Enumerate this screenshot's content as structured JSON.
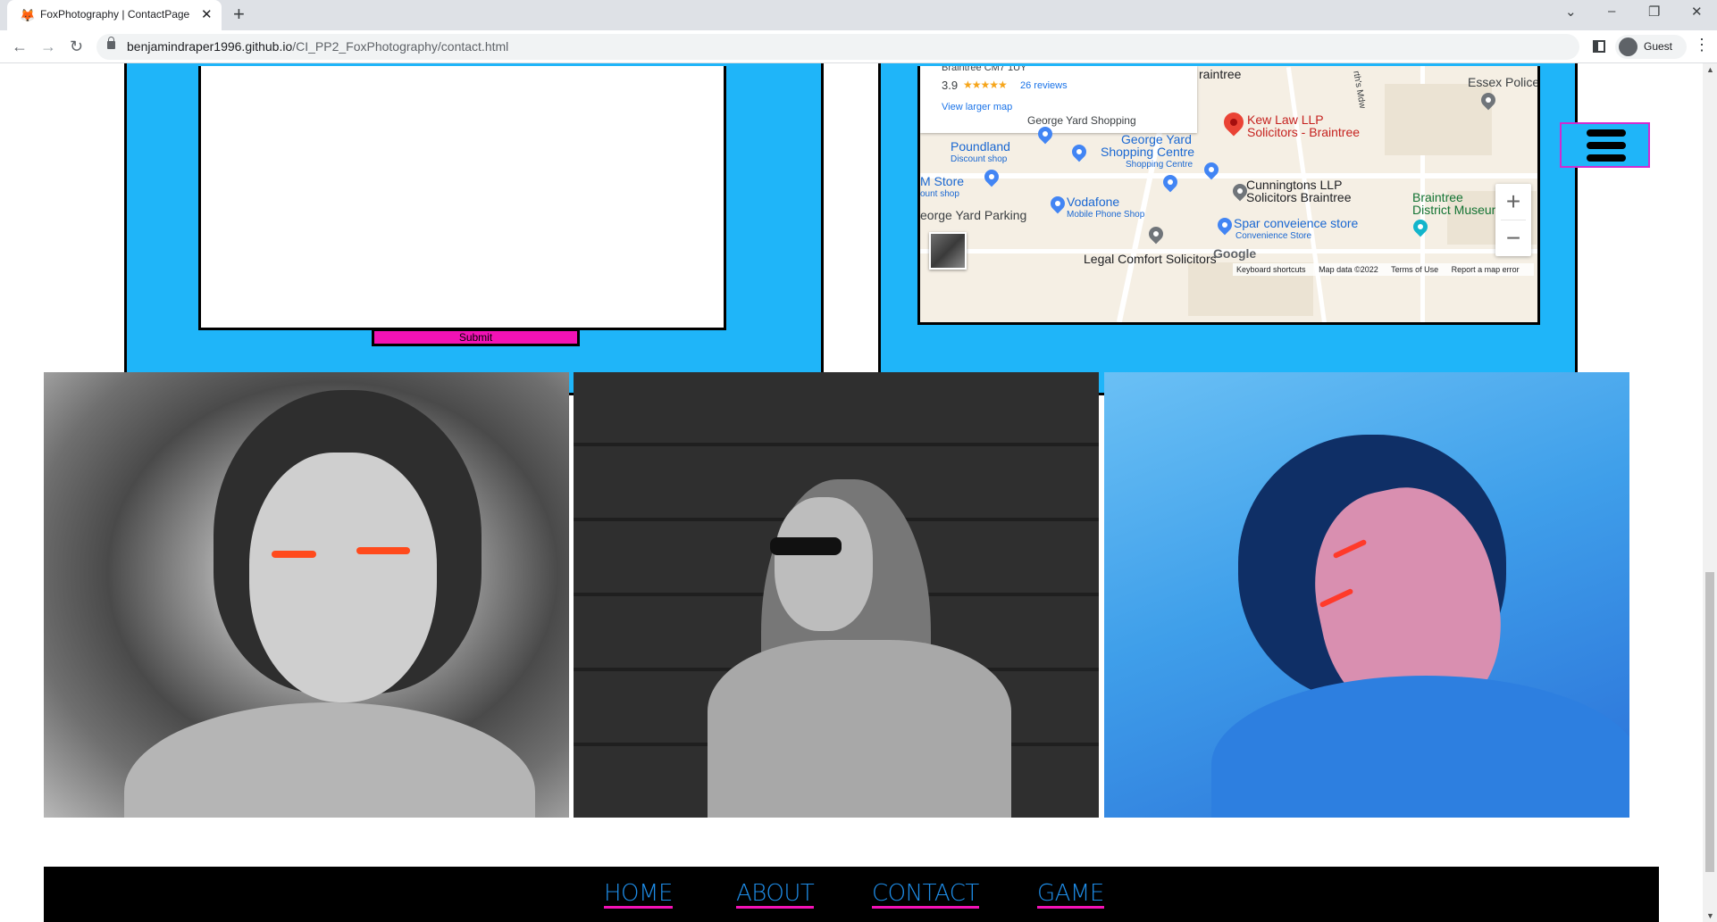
{
  "browser": {
    "tab_title": "FoxPhotography | ContactPage",
    "url_domain": "benjamindraper1996.github.io",
    "url_path": "/CI_PP2_FoxPhotography/contact.html",
    "profile_label": "Guest"
  },
  "contact_form": {
    "submit_label": "Submit"
  },
  "map": {
    "card_partial_text": "Braintree CM7 1UY",
    "rating": "3.9",
    "stars": "★★★★★",
    "reviews": "26 reviews",
    "view_larger": "View larger map",
    "labels": {
      "essex_police": "Essex Police",
      "raintree": "raintree",
      "kew_law_line1": "Kew Law LLP",
      "kew_law_line2": "Solicitors - Braintree",
      "poundland": "Poundland",
      "poundland_sub": "Discount shop",
      "george_yard_centre_line1": "George Yard",
      "george_yard_centre_line2": "Shopping Centre",
      "george_yard_centre_sub": "Shopping Centre",
      "m_store": "M Store",
      "m_store_sub": "ount shop",
      "cunningtons_line1": "Cunningtons LLP",
      "cunningtons_line2": "Solicitors Braintree",
      "braintree_museum_line1": "Braintree",
      "braintree_museum_line2": "District Museum",
      "vodafone": "Vodafone",
      "vodafone_sub": "Mobile Phone Shop",
      "george_yard_parking": "eorge Yard Parking",
      "spar": "Spar conveience store",
      "spar_sub": "Convenience Store",
      "legal_comfort": "Legal Comfort Solicitors",
      "george_yard_shopping_top": "George Yard Shopping",
      "street_label": "rth's Mdw"
    },
    "google_logo": "Google",
    "footer": {
      "keyboard": "Keyboard shortcuts",
      "map_data": "Map data ©2022",
      "terms": "Terms of Use",
      "report": "Report a map error"
    },
    "zoom_in": "+",
    "zoom_out": "−"
  },
  "footer_nav": {
    "home": "HOME",
    "about": "ABOUT",
    "contact": "CONTACT",
    "game": "GAME"
  },
  "colors": {
    "panel_blue": "#1fb5f9",
    "accent_pink": "#f212b5",
    "link_blue": "#1e8de8"
  }
}
